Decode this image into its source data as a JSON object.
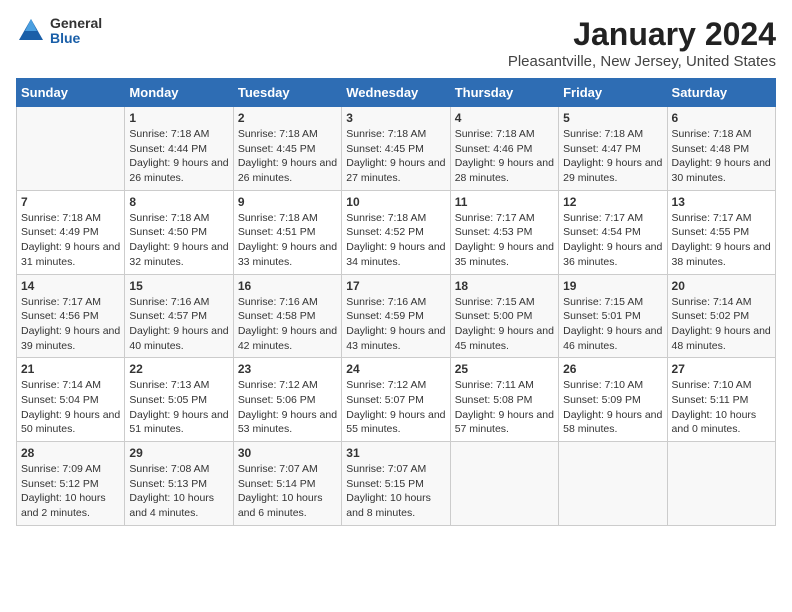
{
  "header": {
    "logo_general": "General",
    "logo_blue": "Blue",
    "month_title": "January 2024",
    "location": "Pleasantville, New Jersey, United States"
  },
  "days_of_week": [
    "Sunday",
    "Monday",
    "Tuesday",
    "Wednesday",
    "Thursday",
    "Friday",
    "Saturday"
  ],
  "weeks": [
    [
      {
        "day": "",
        "sunrise": "",
        "sunset": "",
        "daylight": ""
      },
      {
        "day": "1",
        "sunrise": "Sunrise: 7:18 AM",
        "sunset": "Sunset: 4:44 PM",
        "daylight": "Daylight: 9 hours and 26 minutes."
      },
      {
        "day": "2",
        "sunrise": "Sunrise: 7:18 AM",
        "sunset": "Sunset: 4:45 PM",
        "daylight": "Daylight: 9 hours and 26 minutes."
      },
      {
        "day": "3",
        "sunrise": "Sunrise: 7:18 AM",
        "sunset": "Sunset: 4:45 PM",
        "daylight": "Daylight: 9 hours and 27 minutes."
      },
      {
        "day": "4",
        "sunrise": "Sunrise: 7:18 AM",
        "sunset": "Sunset: 4:46 PM",
        "daylight": "Daylight: 9 hours and 28 minutes."
      },
      {
        "day": "5",
        "sunrise": "Sunrise: 7:18 AM",
        "sunset": "Sunset: 4:47 PM",
        "daylight": "Daylight: 9 hours and 29 minutes."
      },
      {
        "day": "6",
        "sunrise": "Sunrise: 7:18 AM",
        "sunset": "Sunset: 4:48 PM",
        "daylight": "Daylight: 9 hours and 30 minutes."
      }
    ],
    [
      {
        "day": "7",
        "sunrise": "Sunrise: 7:18 AM",
        "sunset": "Sunset: 4:49 PM",
        "daylight": "Daylight: 9 hours and 31 minutes."
      },
      {
        "day": "8",
        "sunrise": "Sunrise: 7:18 AM",
        "sunset": "Sunset: 4:50 PM",
        "daylight": "Daylight: 9 hours and 32 minutes."
      },
      {
        "day": "9",
        "sunrise": "Sunrise: 7:18 AM",
        "sunset": "Sunset: 4:51 PM",
        "daylight": "Daylight: 9 hours and 33 minutes."
      },
      {
        "day": "10",
        "sunrise": "Sunrise: 7:18 AM",
        "sunset": "Sunset: 4:52 PM",
        "daylight": "Daylight: 9 hours and 34 minutes."
      },
      {
        "day": "11",
        "sunrise": "Sunrise: 7:17 AM",
        "sunset": "Sunset: 4:53 PM",
        "daylight": "Daylight: 9 hours and 35 minutes."
      },
      {
        "day": "12",
        "sunrise": "Sunrise: 7:17 AM",
        "sunset": "Sunset: 4:54 PM",
        "daylight": "Daylight: 9 hours and 36 minutes."
      },
      {
        "day": "13",
        "sunrise": "Sunrise: 7:17 AM",
        "sunset": "Sunset: 4:55 PM",
        "daylight": "Daylight: 9 hours and 38 minutes."
      }
    ],
    [
      {
        "day": "14",
        "sunrise": "Sunrise: 7:17 AM",
        "sunset": "Sunset: 4:56 PM",
        "daylight": "Daylight: 9 hours and 39 minutes."
      },
      {
        "day": "15",
        "sunrise": "Sunrise: 7:16 AM",
        "sunset": "Sunset: 4:57 PM",
        "daylight": "Daylight: 9 hours and 40 minutes."
      },
      {
        "day": "16",
        "sunrise": "Sunrise: 7:16 AM",
        "sunset": "Sunset: 4:58 PM",
        "daylight": "Daylight: 9 hours and 42 minutes."
      },
      {
        "day": "17",
        "sunrise": "Sunrise: 7:16 AM",
        "sunset": "Sunset: 4:59 PM",
        "daylight": "Daylight: 9 hours and 43 minutes."
      },
      {
        "day": "18",
        "sunrise": "Sunrise: 7:15 AM",
        "sunset": "Sunset: 5:00 PM",
        "daylight": "Daylight: 9 hours and 45 minutes."
      },
      {
        "day": "19",
        "sunrise": "Sunrise: 7:15 AM",
        "sunset": "Sunset: 5:01 PM",
        "daylight": "Daylight: 9 hours and 46 minutes."
      },
      {
        "day": "20",
        "sunrise": "Sunrise: 7:14 AM",
        "sunset": "Sunset: 5:02 PM",
        "daylight": "Daylight: 9 hours and 48 minutes."
      }
    ],
    [
      {
        "day": "21",
        "sunrise": "Sunrise: 7:14 AM",
        "sunset": "Sunset: 5:04 PM",
        "daylight": "Daylight: 9 hours and 50 minutes."
      },
      {
        "day": "22",
        "sunrise": "Sunrise: 7:13 AM",
        "sunset": "Sunset: 5:05 PM",
        "daylight": "Daylight: 9 hours and 51 minutes."
      },
      {
        "day": "23",
        "sunrise": "Sunrise: 7:12 AM",
        "sunset": "Sunset: 5:06 PM",
        "daylight": "Daylight: 9 hours and 53 minutes."
      },
      {
        "day": "24",
        "sunrise": "Sunrise: 7:12 AM",
        "sunset": "Sunset: 5:07 PM",
        "daylight": "Daylight: 9 hours and 55 minutes."
      },
      {
        "day": "25",
        "sunrise": "Sunrise: 7:11 AM",
        "sunset": "Sunset: 5:08 PM",
        "daylight": "Daylight: 9 hours and 57 minutes."
      },
      {
        "day": "26",
        "sunrise": "Sunrise: 7:10 AM",
        "sunset": "Sunset: 5:09 PM",
        "daylight": "Daylight: 9 hours and 58 minutes."
      },
      {
        "day": "27",
        "sunrise": "Sunrise: 7:10 AM",
        "sunset": "Sunset: 5:11 PM",
        "daylight": "Daylight: 10 hours and 0 minutes."
      }
    ],
    [
      {
        "day": "28",
        "sunrise": "Sunrise: 7:09 AM",
        "sunset": "Sunset: 5:12 PM",
        "daylight": "Daylight: 10 hours and 2 minutes."
      },
      {
        "day": "29",
        "sunrise": "Sunrise: 7:08 AM",
        "sunset": "Sunset: 5:13 PM",
        "daylight": "Daylight: 10 hours and 4 minutes."
      },
      {
        "day": "30",
        "sunrise": "Sunrise: 7:07 AM",
        "sunset": "Sunset: 5:14 PM",
        "daylight": "Daylight: 10 hours and 6 minutes."
      },
      {
        "day": "31",
        "sunrise": "Sunrise: 7:07 AM",
        "sunset": "Sunset: 5:15 PM",
        "daylight": "Daylight: 10 hours and 8 minutes."
      },
      {
        "day": "",
        "sunrise": "",
        "sunset": "",
        "daylight": ""
      },
      {
        "day": "",
        "sunrise": "",
        "sunset": "",
        "daylight": ""
      },
      {
        "day": "",
        "sunrise": "",
        "sunset": "",
        "daylight": ""
      }
    ]
  ]
}
